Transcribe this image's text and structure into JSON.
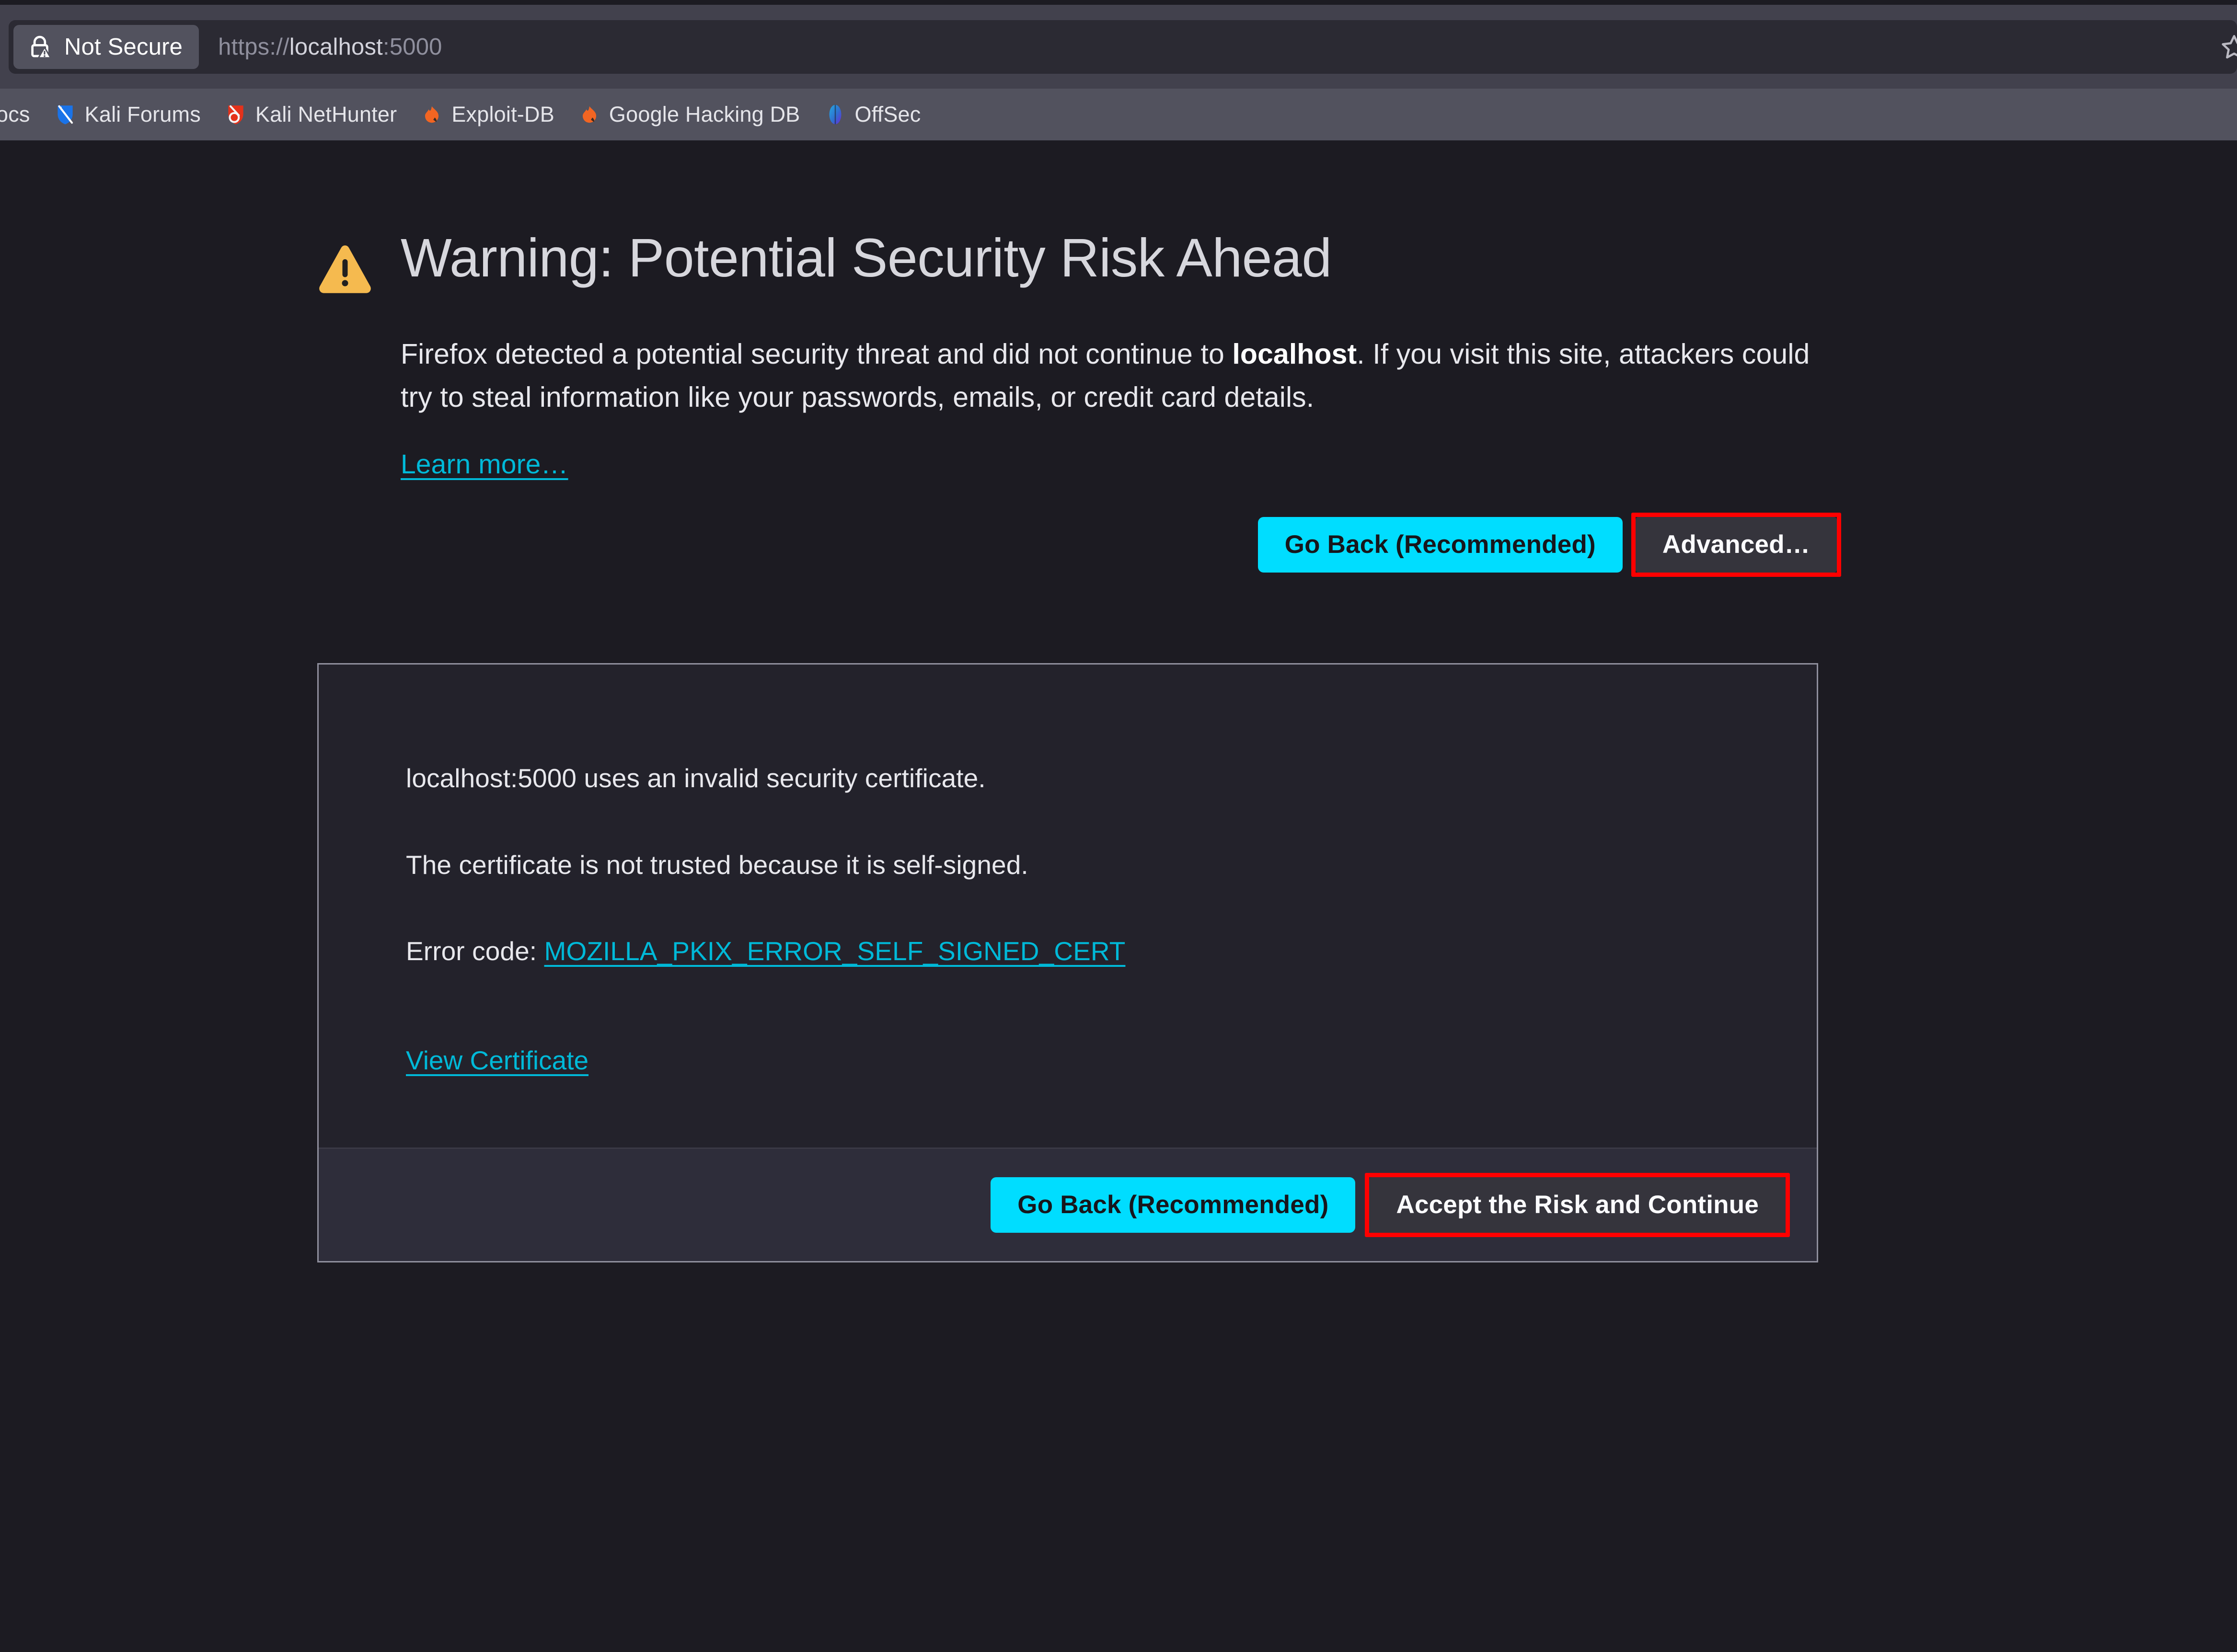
{
  "browser": {
    "identity": {
      "icon": "lock-warning-icon",
      "label": "Not Secure"
    },
    "url": {
      "scheme": "https://",
      "host": "localhost",
      "port": ":5000",
      "full": "https://localhost:5000"
    },
    "urlbar_right_icon": "bookmark-star-icon",
    "bookmarks": [
      {
        "label": "ocs",
        "icon": "kali-docs-icon",
        "clipped": true
      },
      {
        "label": "Kali Forums",
        "icon": "kali-forums-icon",
        "clipped": false
      },
      {
        "label": "Kali NetHunter",
        "icon": "kali-nethunter-icon",
        "clipped": false
      },
      {
        "label": "Exploit-DB",
        "icon": "exploit-db-icon",
        "clipped": false
      },
      {
        "label": "Google Hacking DB",
        "icon": "google-hacking-db-icon",
        "clipped": false
      },
      {
        "label": "OffSec",
        "icon": "offsec-icon",
        "clipped": false
      }
    ]
  },
  "page": {
    "warning_icon": "warning-triangle-icon",
    "title": "Warning: Potential Security Risk Ahead",
    "body_part1": "Firefox detected a potential security threat and did not continue to ",
    "body_host": "localhost",
    "body_part2": ". If you visit this site, attackers could try to steal information like your passwords, emails, or credit card details.",
    "learn_more": "Learn more…",
    "go_back_label": "Go Back (Recommended)",
    "advanced_label": "Advanced…"
  },
  "cert_panel": {
    "line_invalid": "localhost:5000 uses an invalid security certificate.",
    "line_reason": "The certificate is not trusted because it is self-signed.",
    "error_code_label": "Error code: ",
    "error_code_value": "MOZILLA_PKIX_ERROR_SELF_SIGNED_CERT",
    "view_certificate": "View Certificate",
    "go_back_label": "Go Back (Recommended)",
    "accept_risk_label": "Accept the Risk and Continue"
  },
  "colors": {
    "page_bg": "#1c1b22",
    "chrome_bg": "#42414d",
    "bookmarks_bg": "#52525e",
    "urlbar_bg": "#2b2a33",
    "accent_cyan": "#00ddff",
    "link_cyan": "#00b9d8",
    "warning_amber": "#f5ba4f",
    "annotation_red": "#ff0000",
    "panel_bg": "#23222b",
    "panel_border": "#8f8f9d",
    "panel_footer_bg": "#2e2d3a",
    "button_secondary_bg": "#35343c"
  }
}
